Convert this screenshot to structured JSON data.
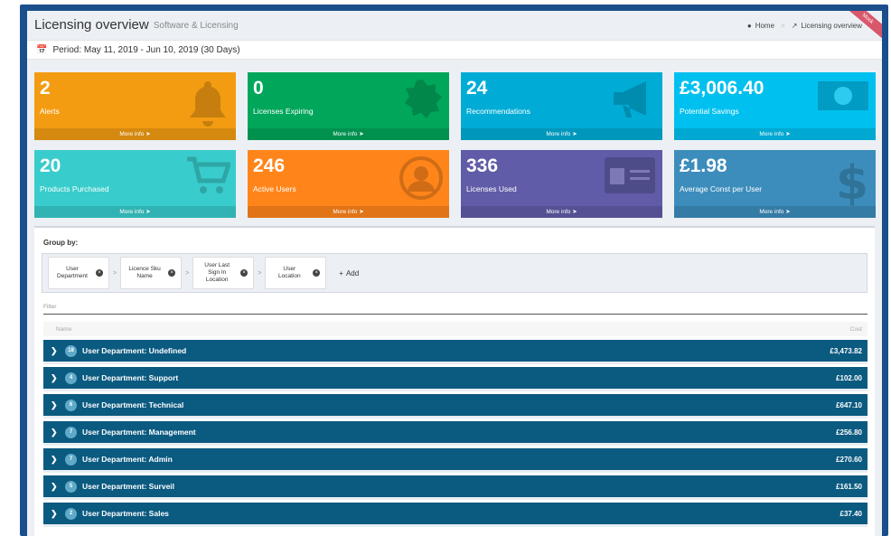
{
  "header": {
    "title": "Licensing overview",
    "subtitle": "Software & Licensing",
    "breadcrumb_home": "Home",
    "breadcrumb_current": "Licensing overview",
    "ribbon": "Mock"
  },
  "period": "Period: May 11, 2019 - Jun 10, 2019 (30 Days)",
  "boxes": [
    {
      "value": "2",
      "label": "Alerts",
      "more": "More info",
      "color": "#f39c12"
    },
    {
      "value": "0",
      "label": "Licenses Expiring",
      "more": "More info",
      "color": "#00a65a"
    },
    {
      "value": "24",
      "label": "Recommendations",
      "more": "More info",
      "color": "#00acd6"
    },
    {
      "value": "£3,006.40",
      "label": "Potential Savings",
      "more": "More info",
      "color": "#00c0ef"
    },
    {
      "value": "20",
      "label": "Products Purchased",
      "more": "More info",
      "color": "#39cccc"
    },
    {
      "value": "246",
      "label": "Active Users",
      "more": "More info",
      "color": "#ff851b"
    },
    {
      "value": "336",
      "label": "Licenses Used",
      "more": "More info",
      "color": "#605ca8"
    },
    {
      "value": "£1.98",
      "label": "Average Const per User",
      "more": "More info",
      "color": "#3c8dbc"
    }
  ],
  "group_by": {
    "label": "Group by:",
    "chips": [
      "User Department",
      "Licence Sku Name",
      "User Last Sign In Location",
      "User Location"
    ],
    "add_label": "Add"
  },
  "filter_placeholder": "Filter",
  "table": {
    "col_name": "Name",
    "col_cost": "Cost",
    "rows": [
      {
        "count": "18",
        "name": "User Department: Undefined",
        "cost": "£3,473.82"
      },
      {
        "count": "4",
        "name": "User Department: Support",
        "cost": "£102.00"
      },
      {
        "count": "6",
        "name": "User Department: Technical",
        "cost": "£647.10"
      },
      {
        "count": "7",
        "name": "User Department: Management",
        "cost": "£256.80"
      },
      {
        "count": "7",
        "name": "User Department: Admin",
        "cost": "£270.60"
      },
      {
        "count": "5",
        "name": "User Department: Surveil",
        "cost": "£161.50"
      },
      {
        "count": "2",
        "name": "User Department: Sales",
        "cost": "£37.40"
      }
    ]
  }
}
